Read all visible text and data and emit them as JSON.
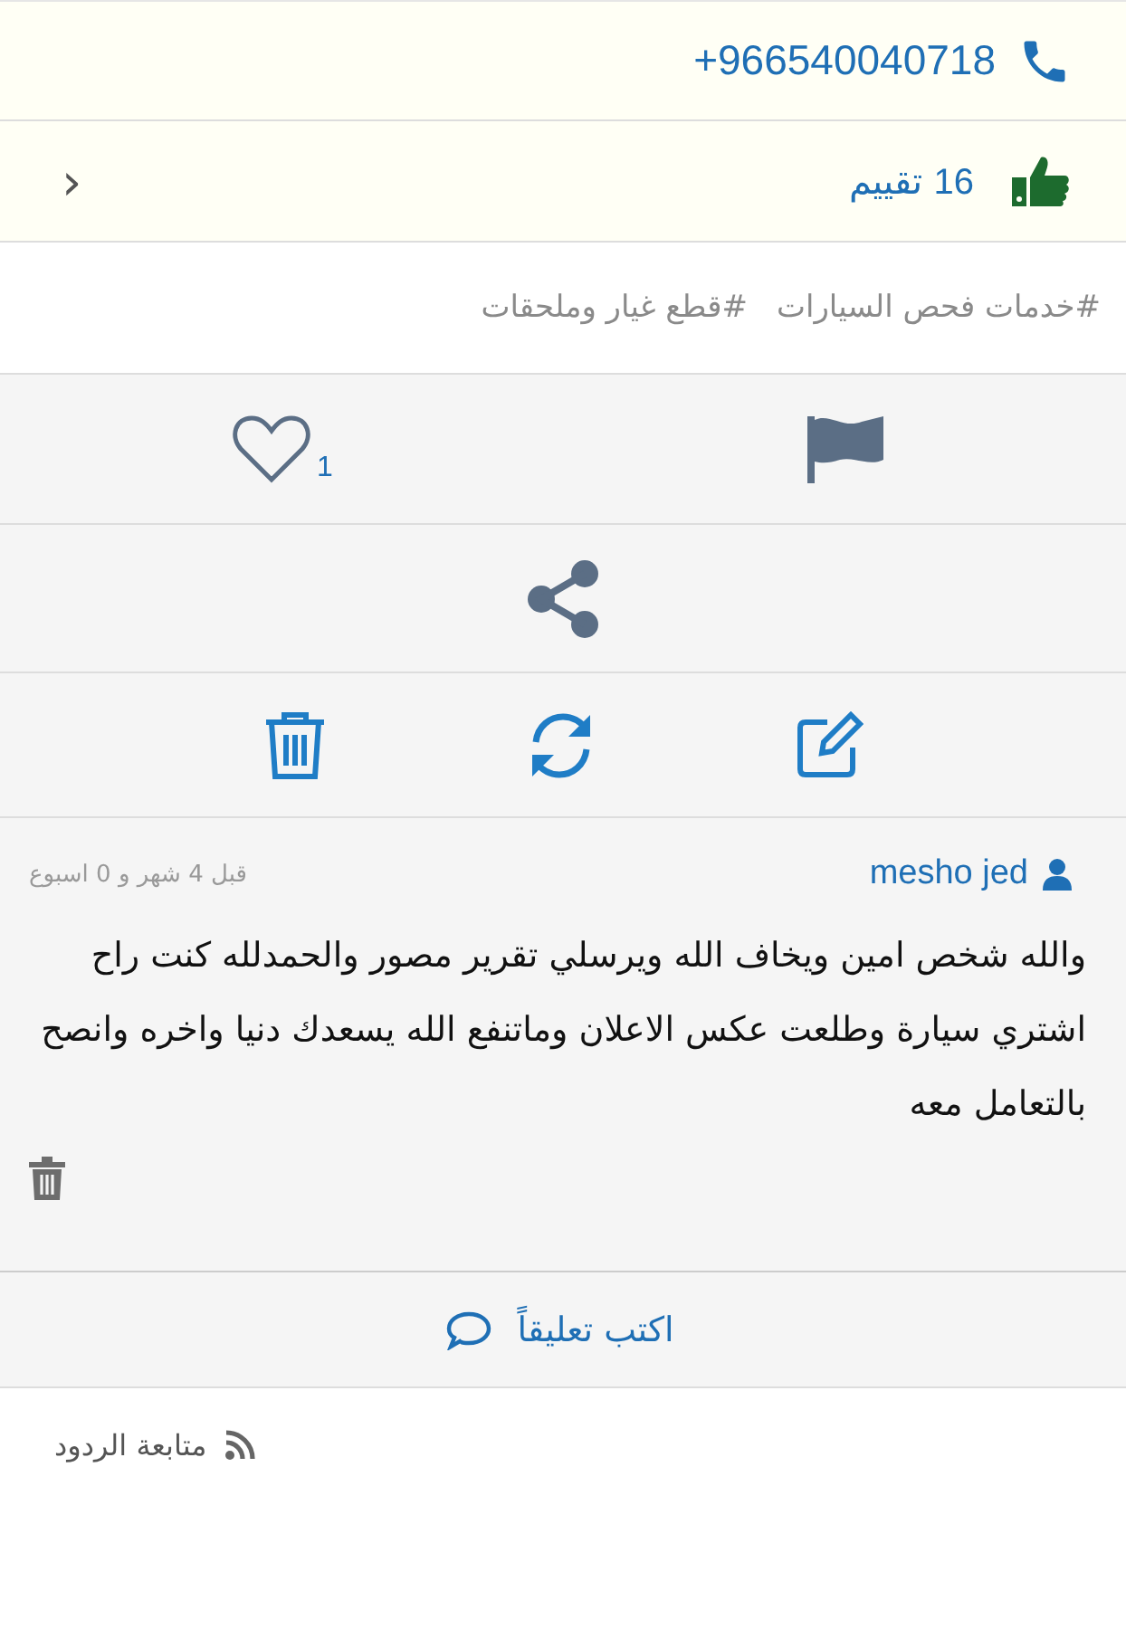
{
  "phone": "+966540040718",
  "rating": {
    "count": "16",
    "label": "تقييم",
    "chevron": "‹"
  },
  "tags": [
    "#خدمات فحص السيارات",
    "#قطع غيار وملحقات"
  ],
  "likes": {
    "count": "1"
  },
  "comment": {
    "author": "mesho jed",
    "time": "قبل 4 شهر و 0 اسبوع",
    "text": "والله شخص امين ويخاف الله ويرسلي تقرير مصور والحمدلله كنت راح اشتري سيارة وطلعت عكس الاعلان وماتنفع الله يسعدك دنيا واخره وانصح بالتعامل معه"
  },
  "write_comment": "اكتب تعليقاً",
  "follow_replies": "متابعة الردود"
}
